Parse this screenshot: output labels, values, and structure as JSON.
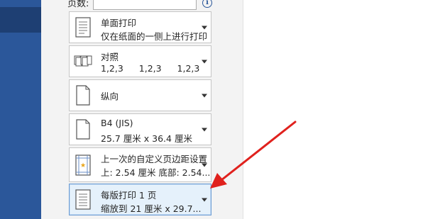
{
  "settings": {
    "pages_label": "页数:",
    "pages_value": "",
    "options": [
      {
        "id": "sides",
        "line1": "单面打印",
        "line2": "仅在纸面的一侧上进行打印"
      },
      {
        "id": "collate",
        "line1": "对照",
        "line2": "1,2,3 1,2,3 1,2,3"
      },
      {
        "id": "orientation",
        "line1": "纵向"
      },
      {
        "id": "paper",
        "line1": "B4 (JIS)",
        "line2": "25.7 厘米 x 36.4 厘米"
      },
      {
        "id": "margins",
        "line1": "上一次的自定义页边距设置",
        "line2": "上: 2.54 厘米 底部: 2.54..."
      },
      {
        "id": "pages_per_sheet",
        "line1": "每版打印 1 页",
        "line2": "缩放到 21 厘米 x 29.7..."
      }
    ]
  },
  "colors": {
    "sidebar": "#2b579a",
    "selected_bg": "#e5f1fb",
    "annotation_arrow": "#e0211d"
  },
  "icons": {
    "sides": "single-side-print-icon",
    "collate": "collate-icon",
    "orientation": "portrait-page-icon",
    "paper": "paper-size-icon",
    "margins": "margins-icon",
    "pages_per_sheet": "pages-per-sheet-icon"
  }
}
